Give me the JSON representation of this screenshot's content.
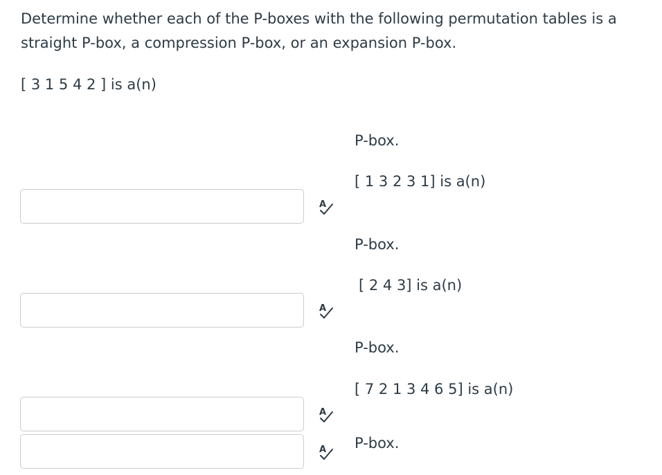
{
  "question": {
    "line1": "Determine whether each of the P-boxes with the following permutation tables is a",
    "line2": "straight P-box, a compression P-box, or an expansion P-box."
  },
  "items": [
    {
      "prompt": "[ 3 1 5 4 2 ] is a(n)",
      "suffix": "P-box.",
      "answer_value": "",
      "answer_placeholder": ""
    },
    {
      "prompt": "[ 1 3 2 3 1] is a(n)",
      "suffix": "P-box.",
      "answer_value": "",
      "answer_placeholder": ""
    },
    {
      "prompt": "[ 2 4 3] is a(n)",
      "suffix": "P-box.",
      "answer_value": "",
      "answer_placeholder": ""
    },
    {
      "prompt": "[ 7 2 1 3 4 6 5]  is a(n)",
      "suffix": "P-box.",
      "answer_value": "",
      "answer_placeholder": ""
    }
  ],
  "icons": {
    "answer_tool": "spellcheck-icon"
  },
  "colors": {
    "text": "#2d3b45",
    "input_border": "#c7cdd1",
    "icon": "#2d3b45"
  }
}
